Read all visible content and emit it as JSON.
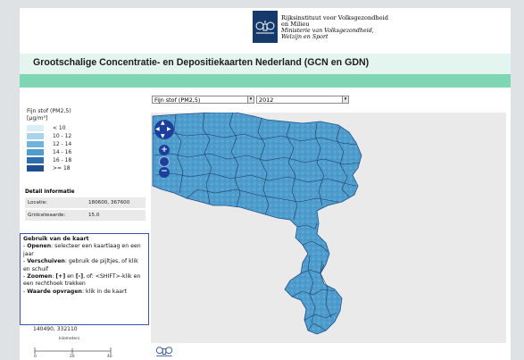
{
  "header": {
    "org_line1": "Rijksinstituut voor Volksgezondheid",
    "org_line2": "en Milieu",
    "ministry_line1": "Ministerie van Volksgezondheid,",
    "ministry_line2": "Welzijn en Sport"
  },
  "title": "Grootschalige Concentratie- en Depositiekaarten Nederland (GCN en GDN)",
  "controls": {
    "substance": "Fijn stof (PM2,5)",
    "year": "2012"
  },
  "legend": {
    "title_line1": "Fijn stof (PM2,5)",
    "title_line2": "[µg/m³]",
    "items": [
      {
        "label": "< 10",
        "color": "#d9eef7"
      },
      {
        "label": "10 - 12",
        "color": "#aad3ea"
      },
      {
        "label": "12 - 14",
        "color": "#6fb4dc"
      },
      {
        "label": "14 - 16",
        "color": "#4f9dcc"
      },
      {
        "label": "16 - 18",
        "color": "#2f6fae"
      },
      {
        "label": ">= 18",
        "color": "#1c4f8c"
      }
    ]
  },
  "detail": {
    "title": "Detail informatie",
    "location_label": "Locatie:",
    "location_value": "180600, 367600",
    "grid_label": "Gridcelwaarde:",
    "grid_value": "15.0"
  },
  "help": {
    "title": "Gebruik van de kaart",
    "open_label": "Openen",
    "open_text": ": selecteer een kaartlaag en een jaar",
    "move_label": "Verschuiven",
    "move_text": ": gebruik de pijltjes, of klik en schuif",
    "zoom_label": "Zoomen",
    "zoom_plus": "[+]",
    "zoom_and": " en ",
    "zoom_minus": "[-]",
    "zoom_text": ", of: <SHIFT>-klik en een rechthoek trekken",
    "value_label": "Waarde opvragen",
    "value_text": ": klik in de kaart"
  },
  "coordinates": "140490, 332110",
  "scale": {
    "unit": "kilometers",
    "ticks": [
      "0",
      "20",
      "40"
    ]
  },
  "map_controls": {
    "up": "▲",
    "down": "▼",
    "left": "◀",
    "right": "▶",
    "zoom_in": "+",
    "zoom_out": "−"
  },
  "colors": {
    "title_band": "#e4f4ef",
    "green_band": "#7fd6b5",
    "help_border": "#3b53b7",
    "map_fill": "#4f9dcc",
    "map_background": "#eaeaea",
    "logo_blue": "#15396b"
  }
}
